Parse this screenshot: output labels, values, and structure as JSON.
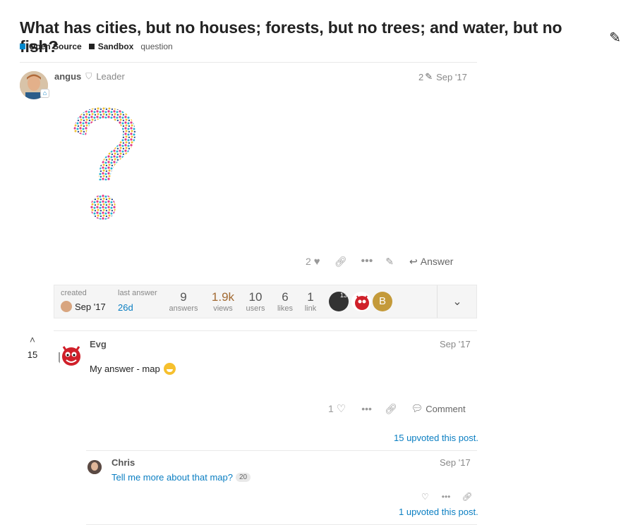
{
  "topic": {
    "title": "What has cities, but no houses; forests, but no trees; and water, but no fish?",
    "categories": [
      {
        "name": "Open Source",
        "color": "#0088cc"
      },
      {
        "name": "Sandbox",
        "color": "#222222"
      }
    ],
    "tag": "question"
  },
  "op": {
    "username": "angus",
    "flair": "Leader",
    "edits": "2",
    "date": "Sep '17",
    "likes": "2",
    "answer_label": "Answer"
  },
  "summary": {
    "created_label": "created",
    "created_date": "Sep '17",
    "last_answer_label": "last answer",
    "last_answer_value": "26d",
    "answers": {
      "num": "9",
      "label": "answers"
    },
    "views": {
      "num": "1.9k",
      "label": "views"
    },
    "users": {
      "num": "10",
      "label": "users"
    },
    "likes": {
      "num": "6",
      "label": "likes"
    },
    "links": {
      "num": "1",
      "label": "link"
    },
    "participant_badge": "13",
    "participant_letter": "B"
  },
  "answer": {
    "votes": "15",
    "username": "Evg",
    "date": "Sep '17",
    "body": "My answer - map",
    "likes": "1",
    "comment_label": "Comment",
    "upvoted": "15 upvoted this post."
  },
  "comment": {
    "username": "Chris",
    "date": "Sep '17",
    "body": "Tell me more about that map?",
    "count": "20",
    "upvoted": "1 upvoted this post."
  },
  "colors": {
    "accent": "#0a7ec2",
    "views": "#a26a32",
    "letter_avatar": "#c49a3a"
  }
}
